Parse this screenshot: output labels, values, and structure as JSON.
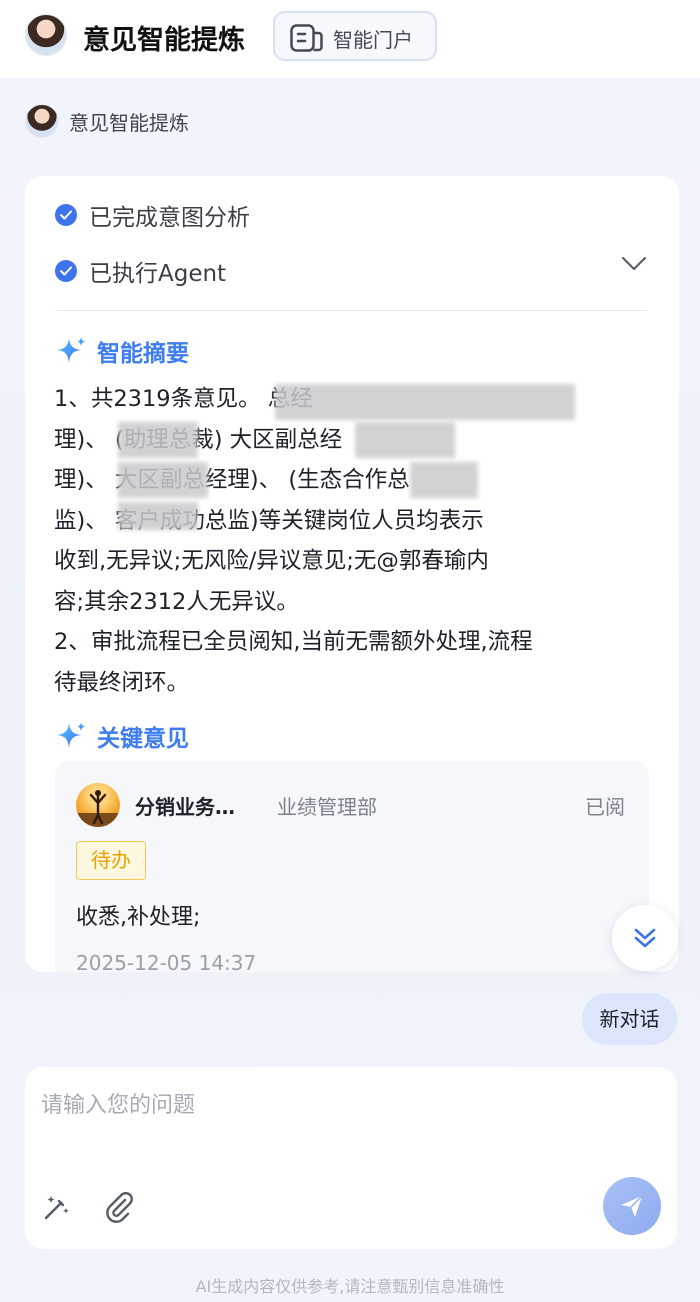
{
  "header": {
    "title": "意见智能提炼",
    "portal_label": "智能门户"
  },
  "bot": {
    "name": "意见智能提炼"
  },
  "status": {
    "intent": "已完成意图分析",
    "agent": "已执行Agent"
  },
  "summary": {
    "title": "智能摘要",
    "lines": [
      "1、共2319条意见。                          总经",
      "理)、        (助理总裁)                大区副总经",
      "理)、        大区副总经理)、       (生态合作总",
      "监)、       客户成功总监)等关键岗位人员均表示",
      "收到,无异议;无风险/异议意见;无@郭春瑜内",
      "容;其余2312人无异议。",
      "2、审批流程已全员阅知,当前无需额外处理,流程",
      "待最终闭环。"
    ]
  },
  "key_opinions": {
    "title": "关键意见",
    "item": {
      "name": "分销业务…",
      "dept": "业绩管理部",
      "read_status": "已阅",
      "tag": "待办",
      "text": "收悉,补处理;",
      "time": "2025-12-05 14:37"
    }
  },
  "new_chat": "新对话",
  "input": {
    "placeholder": "请输入您的问题"
  },
  "footer": "AI生成内容仅供参考,请注意甄别信息准确性",
  "colors": {
    "accent": "#3e73ee",
    "tag": "#e8a100"
  }
}
